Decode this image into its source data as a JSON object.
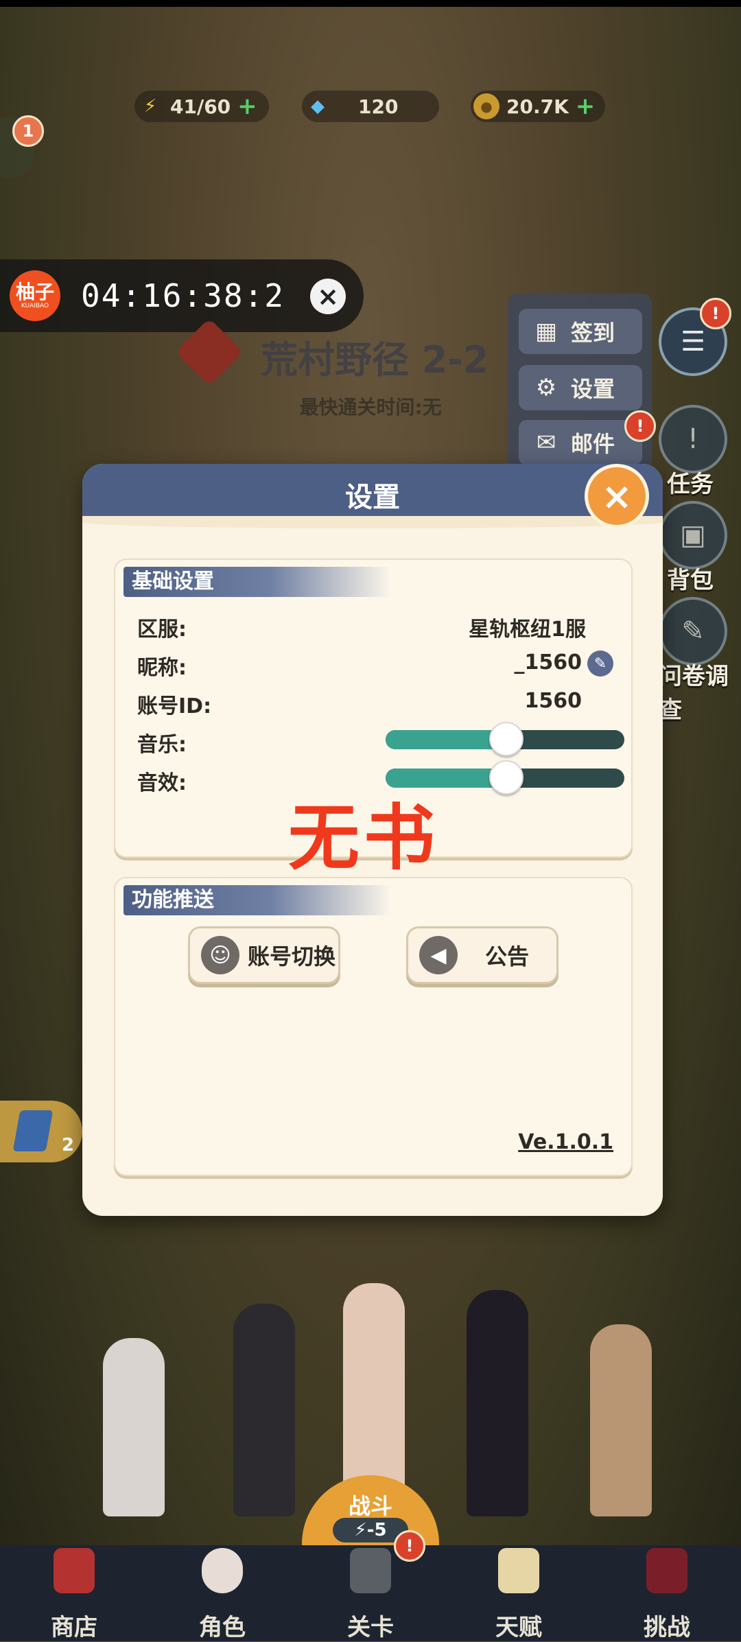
{
  "resources": {
    "energy": {
      "value": "41/60",
      "icon": "lightning-icon"
    },
    "diamond": {
      "value": "120",
      "icon": "diamond-icon"
    },
    "gold": {
      "value": "20.7K",
      "icon": "coin-icon"
    }
  },
  "notification_badge": "1",
  "timer": {
    "logo_text": "柚子",
    "logo_sub": "KUAIBAO",
    "time": "04:16:38:2"
  },
  "stage": {
    "title": "荒村野径 2-2",
    "subtitle": "最快通关时间:无"
  },
  "right_menu": {
    "checkin": "签到",
    "settings": "设置",
    "mail": "邮件"
  },
  "side_labels": {
    "task": "任务",
    "bag": "背包",
    "survey": "问卷调查"
  },
  "settings": {
    "title": "设置",
    "basic_section": "基础设置",
    "server_label": "区服:",
    "server_value": "星轨枢纽1服",
    "nickname_label": "昵称:",
    "nickname_value": "_1560",
    "account_label": "账号ID:",
    "account_value": "1560",
    "music_label": "音乐:",
    "music_level": 0.5,
    "sfx_label": "音效:",
    "sfx_level": 0.5,
    "watermark": "无书",
    "function_section": "功能推送",
    "switch_account": "账号切换",
    "announcement": "公告",
    "version": "Ve.1.0.1"
  },
  "crystal_count": "2",
  "battle": {
    "label": "战斗",
    "cost": "-5"
  },
  "nav": [
    "商店",
    "角色",
    "关卡",
    "天赋",
    "挑战"
  ],
  "colors": {
    "header": "#4e5f86",
    "modal_bg": "#fbf3e3",
    "slider_fill": "#3aa38f",
    "close": "#f19a3e",
    "watermark": "#f0391c"
  }
}
